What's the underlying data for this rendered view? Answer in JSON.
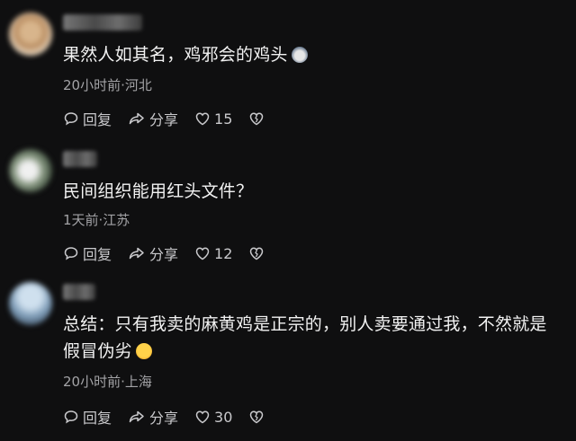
{
  "comments": [
    {
      "text": "果然人如其名，鸡邪会的鸡头",
      "emoji_icon": "cat-face-emoji",
      "meta": "20小时前·河北",
      "reply_label": "回复",
      "share_label": "分享",
      "likes": "15"
    },
    {
      "text": "民间组织能用红头文件？",
      "meta": "1天前·江苏",
      "reply_label": "回复",
      "share_label": "分享",
      "likes": "12"
    },
    {
      "text": "总结：只有我卖的麻黄鸡是正宗的，别人卖要通过我，不然就是假冒伪劣",
      "emoji_icon": "laughing-tears-emoji",
      "meta": "20小时前·上海",
      "reply_label": "回复",
      "share_label": "分享",
      "likes": "30"
    }
  ],
  "colors": {
    "background": "#0f0f10",
    "text": "#f2f2f2",
    "meta": "#a3a3a6",
    "action": "#c9c9cc"
  }
}
